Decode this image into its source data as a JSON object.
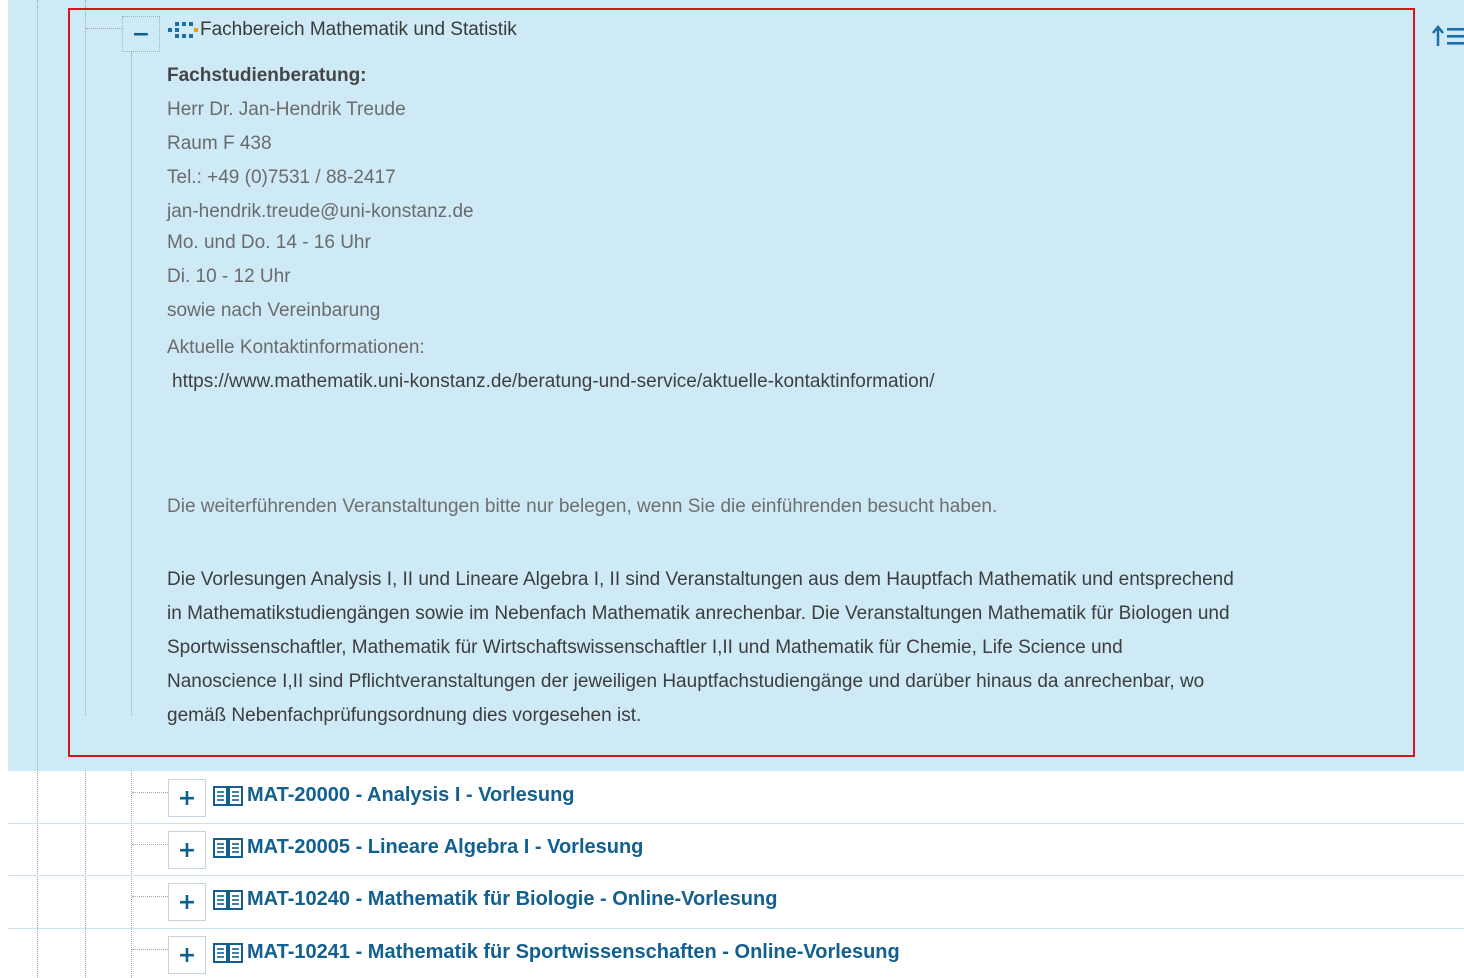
{
  "tree": {
    "sort_icon": "sort-up-icon",
    "expanded_node": {
      "toggle_symbol": "−",
      "icon": "org-unit-icon",
      "title": "Fachbereich Mathematik und Statistik",
      "counseling_heading": "Fachstudienberatung:",
      "contact_lines": [
        "Herr Dr. Jan-Hendrik Treude",
        "Raum F 438",
        "Tel.: +49 (0)7531 / 88-2417",
        "jan-hendrik.treude@uni-konstanz.de",
        "Mo. und Do. 14 - 16 Uhr",
        "Di. 10 - 12 Uhr",
        "sowie nach Vereinbarung",
        "Aktuelle Kontaktinformationen:"
      ],
      "contact_url": "https://www.mathematik.uni-konstanz.de/beratung-und-service/aktuelle-kontaktinformation/",
      "note": "Die weiterführenden Veranstaltungen bitte nur belegen, wenn Sie die einführenden besucht haben.",
      "paragraph_lines": [
        "Die Vorlesungen Analysis I, II und Lineare Algebra I, II sind Veranstaltungen aus dem Hauptfach Mathematik und entsprechend",
        "in Mathematikstudiengängen sowie im Nebenfach Mathematik anrechenbar. Die Veranstaltungen Mathematik für Biologen und",
        "Sportwissenschaftler, Mathematik für Wirtschaftswissenschaftler I,II und Mathematik für Chemie, Life Science und",
        "Nanoscience I,II sind Pflichtveranstaltungen der jeweiligen Hauptfachstudiengänge und darüber hinaus da anrechenbar, wo",
        "gemäß Nebenfachprüfungsordnung dies vorgesehen ist."
      ]
    },
    "courses": [
      {
        "toggle_symbol": "+",
        "icon": "book-icon",
        "label": "MAT-20000 - Analysis I - Vorlesung"
      },
      {
        "toggle_symbol": "+",
        "icon": "book-icon",
        "label": "MAT-20005 - Lineare Algebra I - Vorlesung"
      },
      {
        "toggle_symbol": "+",
        "icon": "book-icon",
        "label": "MAT-10240 - Mathematik für Biologie - Online-Vorlesung"
      },
      {
        "toggle_symbol": "+",
        "icon": "book-icon",
        "label": "MAT-10241 - Mathematik für Sportwissenschaften - Online-Vorlesung"
      }
    ],
    "colors": {
      "highlight_background": "#cdeaf6",
      "selection_border": "#d6161c",
      "link": "#12608f"
    }
  }
}
